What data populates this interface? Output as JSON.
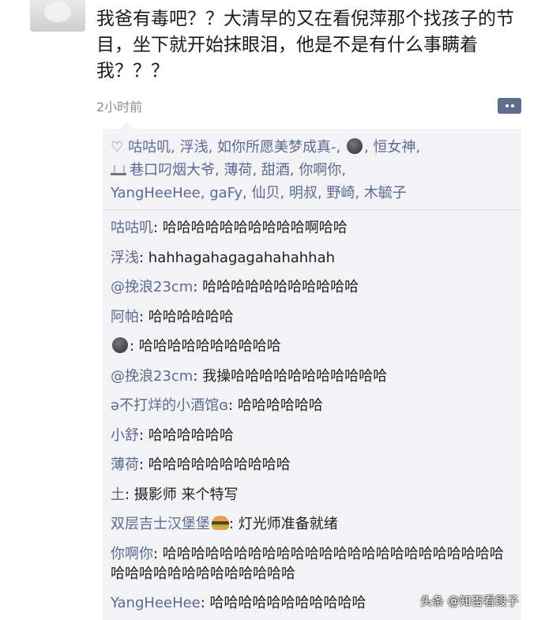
{
  "post": {
    "text": "我爸有毒吧？？大清早的又在看倪萍那个找孩子的节目，坐下就开始抹眼泪，他是不是有什么事瞒着我？？？",
    "time": "2小时前"
  },
  "likes": {
    "line1": "咕咕叽, 浮浅, 如你所愿美梦成真-, ",
    "line1b": ", 恒女神,",
    "line2": "巷口叼烟大爷, 薄荷, 甜酒, 你啊你,",
    "line3": "YangHeeHee, gaFy, 仙贝, 明叔, 野崎, 木毓子"
  },
  "comments": [
    {
      "name": "咕咕叽",
      "text": ": 哈哈哈哈哈哈哈哈哈哈啊哈哈"
    },
    {
      "name": "浮浅",
      "text": ": hahhagahagagahahahhah"
    },
    {
      "name": "@挽浪23cm",
      "text": ": 哈哈哈哈哈哈哈哈哈哈哈"
    },
    {
      "name": "阿帕",
      "text": ": 哈哈哈哈哈哈"
    },
    {
      "name": "",
      "text": ": 哈哈哈哈哈哈哈哈哈哈"
    },
    {
      "name": "@挽浪23cm",
      "text": ": 我操哈哈哈哈哈哈哈哈哈哈哈"
    },
    {
      "name": "ə不打烊的小酒馆ɞ",
      "text": ": 哈哈哈哈哈哈"
    },
    {
      "name": "小舒",
      "text": ": 哈哈哈哈哈哈"
    },
    {
      "name": "薄荷",
      "text": ": 哈哈哈哈哈哈哈哈哈哈"
    },
    {
      "name": "土",
      "text": ": 摄影师 来个特写"
    },
    {
      "name": "双层吉士汉堡堡",
      "text": ": 灯光师准备就绪"
    },
    {
      "name": "你啊你",
      "text": ": 哈哈哈哈哈哈哈哈哈哈哈哈哈哈哈哈哈哈哈哈哈哈哈哈哈哈哈哈哈哈哈哈哈哈哈哈哈"
    },
    {
      "name": "YangHeeHee",
      "text": ": 哈哈哈哈哈哈哈哈哈哈哈"
    }
  ],
  "watermark": "头条 @知否看段子"
}
